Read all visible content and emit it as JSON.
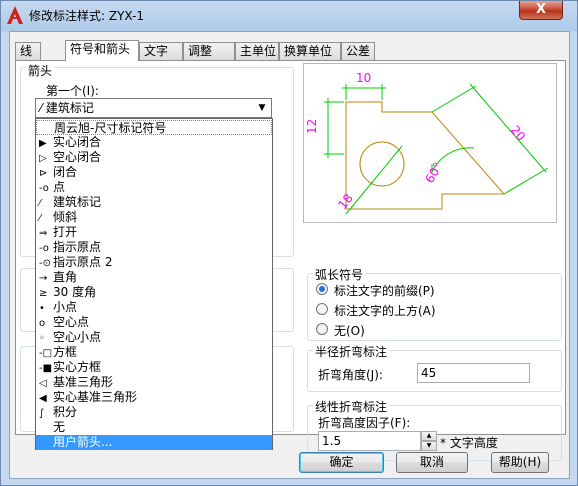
{
  "window": {
    "title": "修改标注样式: ZYX-1",
    "close_label": "X"
  },
  "tabs": [
    "线",
    "符号和箭头",
    "文字",
    "调整",
    "主单位",
    "换算单位",
    "公差"
  ],
  "arrows_group": {
    "label": "箭头",
    "first_label": "第一个(I):",
    "first_value": "建筑标记"
  },
  "dropdown": {
    "items": [
      {
        "glyph": "",
        "label": "周云旭-尺寸标记符号"
      },
      {
        "glyph": "▶",
        "label": "实心闭合"
      },
      {
        "glyph": "▷",
        "label": "空心闭合"
      },
      {
        "glyph": "⊳",
        "label": "闭合"
      },
      {
        "glyph": "-o",
        "label": "点"
      },
      {
        "glyph": "⁄",
        "label": "建筑标记"
      },
      {
        "glyph": "⁄",
        "label": "倾斜"
      },
      {
        "glyph": "⇒",
        "label": "打开"
      },
      {
        "glyph": "-o",
        "label": "指示原点"
      },
      {
        "glyph": "-⊙",
        "label": "指示原点 2"
      },
      {
        "glyph": "→",
        "label": "直角"
      },
      {
        "glyph": "≥",
        "label": "30 度角"
      },
      {
        "glyph": "•",
        "label": "小点"
      },
      {
        "glyph": "o",
        "label": "空心点"
      },
      {
        "glyph": "◦",
        "label": "空心小点"
      },
      {
        "glyph": "-□",
        "label": "方框"
      },
      {
        "glyph": "-■",
        "label": "实心方框"
      },
      {
        "glyph": "◁",
        "label": "基准三角形"
      },
      {
        "glyph": "◀",
        "label": "实心基准三角形"
      },
      {
        "glyph": "∫",
        "label": "积分"
      },
      {
        "glyph": "",
        "label": "无"
      },
      {
        "glyph": "",
        "label": "用户箭头..."
      }
    ]
  },
  "preview": {
    "dims": [
      "10",
      "12",
      "20",
      "18",
      "60°"
    ],
    "colors": {
      "dim_line": "#00cc00",
      "text": "#ff00ff",
      "shape": "#b8860b"
    }
  },
  "arc_length": {
    "label": "弧长符号",
    "options": [
      "标注文字的前缀(P)",
      "标注文字的上方(A)",
      "无(O)"
    ],
    "selected": 0
  },
  "radius_jog": {
    "label": "半径折弯标注",
    "angle_label": "折弯角度(J):",
    "angle_value": "45"
  },
  "linear_jog": {
    "label": "线性折弯标注",
    "factor_label": "折弯高度因子(F):",
    "factor_value": "1.5",
    "factor_suffix": "* 文字高度"
  },
  "buttons": {
    "ok": "确定",
    "cancel": "取消",
    "help": "帮助(H)"
  }
}
